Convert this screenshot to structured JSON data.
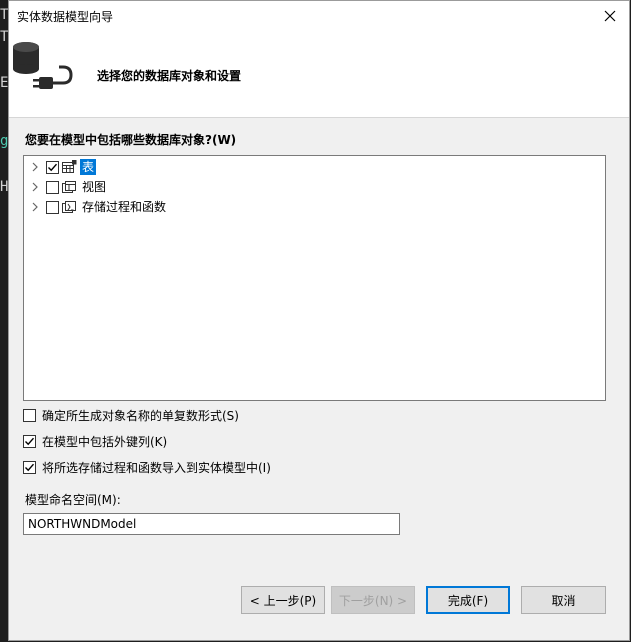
{
  "window": {
    "title": "实体数据模型向导"
  },
  "header": {
    "step_title": "选择您的数据库对象和设置"
  },
  "objects": {
    "label": "您要在模型中包括哪些数据库对象?(W)",
    "items": [
      {
        "label": "表",
        "checked": true,
        "selected": true
      },
      {
        "label": "视图",
        "checked": false,
        "selected": false
      },
      {
        "label": "存储过程和函数",
        "checked": false,
        "selected": false
      }
    ]
  },
  "options": [
    {
      "label": "确定所生成对象名称的单复数形式(S)",
      "checked": false
    },
    {
      "label": "在模型中包括外键列(K)",
      "checked": true
    },
    {
      "label": "将所选存储过程和函数导入到实体模型中(I)",
      "checked": true
    }
  ],
  "namespace": {
    "label": "模型命名空间(M):",
    "value": "NORTHWNDModel"
  },
  "buttons": {
    "prev": "< 上一步(P)",
    "next": "下一步(N) >",
    "finish": "完成(F)",
    "cancel": "取消"
  },
  "background": {
    "glyphs": [
      "T",
      "T",
      "E",
      "g",
      "H"
    ]
  },
  "colors": {
    "accent": "#0078d7",
    "dialog_bg": "#f0f0f0"
  }
}
